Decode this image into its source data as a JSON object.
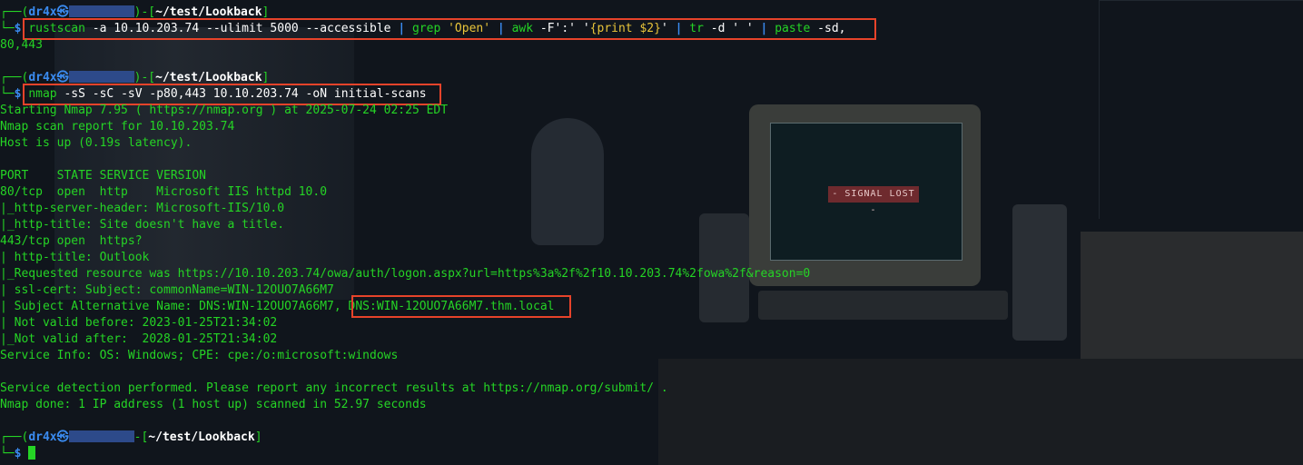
{
  "prompt": {
    "user": "dr4x",
    "at": "㉿",
    "path1": "~/test/Lookback",
    "dollar": "$"
  },
  "commands": {
    "rustscan": {
      "bin": "rustscan",
      "args": " -a 10.10.203.74 --ulimit 5000 --accessible ",
      "pipe1": "|",
      "grep": " grep ",
      "grep_arg": "'Open'",
      "pipe2": " | ",
      "awk": "awk",
      "awk_args": " -F':' '",
      "awk_expr": "{print $2}",
      "awk_end": "' ",
      "pipe3": "| ",
      "tr": "tr",
      "tr_args": " -d ' ' ",
      "pipe4": "| ",
      "paste": "paste",
      "paste_args": " -sd,"
    },
    "rustscan_output": "80,443",
    "nmap": {
      "bin": "nmap",
      "args": " -sS -sC -sV -p80,443 10.10.203.74 -oN initial-scans"
    }
  },
  "output": [
    "Starting Nmap 7.95 ( https://nmap.org ) at 2025-07-24 02:25 EDT",
    "Nmap scan report for 10.10.203.74",
    "Host is up (0.19s latency).",
    "",
    "PORT    STATE SERVICE VERSION",
    "80/tcp  open  http    Microsoft IIS httpd 10.0",
    "|_http-server-header: Microsoft-IIS/10.0",
    "|_http-title: Site doesn't have a title.",
    "443/tcp open  https?",
    "| http-title: Outlook",
    "|_Requested resource was https://10.10.203.74/owa/auth/logon.aspx?url=https%3a%2f%2f10.10.203.74%2fowa%2f&reason=0",
    "| ssl-cert: Subject: commonName=WIN-12OUO7A66M7",
    "| Subject Alternative Name: DNS:WIN-12OUO7A66M7, ",
    "| Not valid before: 2023-01-25T21:34:02",
    "|_Not valid after:  2028-01-25T21:34:02",
    "Service Info: OS: Windows; CPE: cpe:/o:microsoft:windows",
    "",
    "Service detection performed. Please report any incorrect results at https://nmap.org/submit/ .",
    "Nmap done: 1 IP address (1 host up) scanned in 52.97 seconds"
  ],
  "san_highlight": "DNS:WIN-12OUO7A66M7.thm.local",
  "wallpaper": {
    "signal_text": "- SIGNAL LOST -"
  },
  "colors": {
    "prompt_green": "#25d425",
    "command_blue": "#3a8bf0",
    "highlight_red": "#e7432a",
    "string_yellow": "#e9c53a"
  }
}
